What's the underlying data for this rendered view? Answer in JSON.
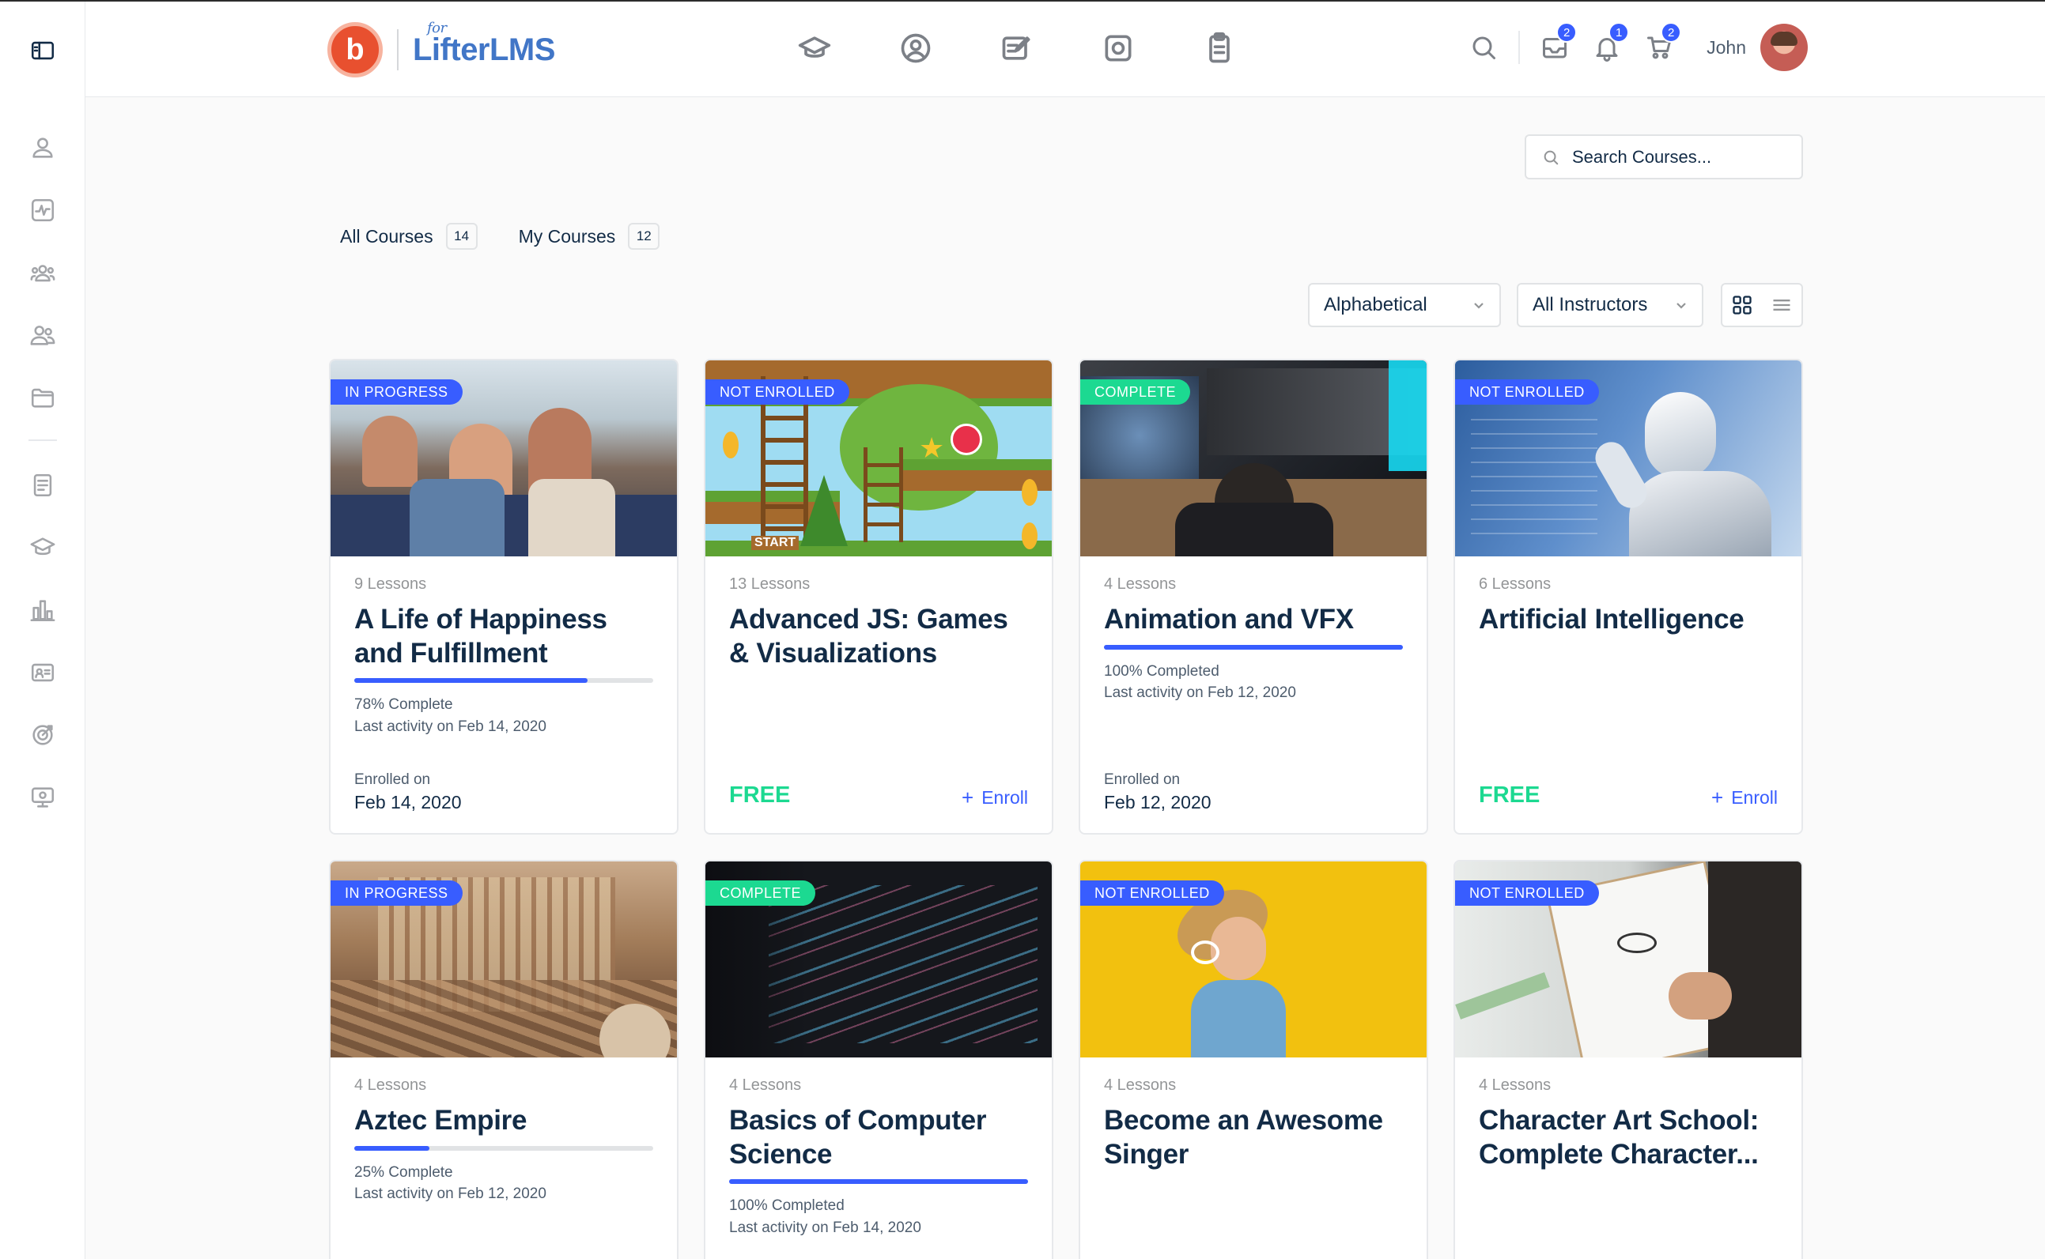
{
  "app": {
    "brand_prefix": "for",
    "brand_name": "LifterLMS",
    "brand_mark": "b",
    "user_name": "John"
  },
  "header_badges": {
    "inbox": "2",
    "notifications": "1",
    "cart": "2"
  },
  "search": {
    "placeholder": "Search Courses..."
  },
  "tabs": [
    {
      "label": "All Courses",
      "count": "14"
    },
    {
      "label": "My Courses",
      "count": "12"
    }
  ],
  "filters": {
    "order": "Alphabetical",
    "instructor": "All Instructors"
  },
  "courses": [
    {
      "status": "IN PROGRESS",
      "lessons": "9 Lessons",
      "title": "A Life of Happiness and Fulfillment",
      "progress": 0.78,
      "progress_text": "78% Complete",
      "last_activity": "Last activity on Feb 14, 2020",
      "enrolled_label": "Enrolled on",
      "enrolled_date": "Feb 14, 2020"
    },
    {
      "status": "NOT ENROLLED",
      "lessons": "13 Lessons",
      "title": "Advanced JS: Games & Visualizations",
      "price": "FREE",
      "enroll": "Enroll",
      "image_text": "START"
    },
    {
      "status": "COMPLETE",
      "lessons": "4 Lessons",
      "title": "Animation and VFX",
      "progress": 1.0,
      "progress_text": "100% Completed",
      "last_activity": "Last activity on Feb 12, 2020",
      "enrolled_label": "Enrolled on",
      "enrolled_date": "Feb 12, 2020"
    },
    {
      "status": "NOT ENROLLED",
      "lessons": "6 Lessons",
      "title": "Artificial Intelligence",
      "price": "FREE",
      "enroll": "Enroll"
    },
    {
      "status": "IN PROGRESS",
      "lessons": "4 Lessons",
      "title": "Aztec Empire",
      "progress": 0.25,
      "progress_text": "25% Complete",
      "last_activity": "Last activity on Feb 12, 2020"
    },
    {
      "status": "COMPLETE",
      "lessons": "4 Lessons",
      "title": "Basics of Computer Science",
      "progress": 1.0,
      "progress_text": "100% Completed",
      "last_activity": "Last activity on Feb 14, 2020"
    },
    {
      "status": "NOT ENROLLED",
      "lessons": "4 Lessons",
      "title": "Become an Awesome Singer"
    },
    {
      "status": "NOT ENROLLED",
      "lessons": "4 Lessons",
      "title": "Character Art School: Complete Character..."
    }
  ],
  "colors": {
    "accent": "#385dff",
    "complete": "#1cd991",
    "brand": "#e8502f",
    "text": "#122b46"
  }
}
